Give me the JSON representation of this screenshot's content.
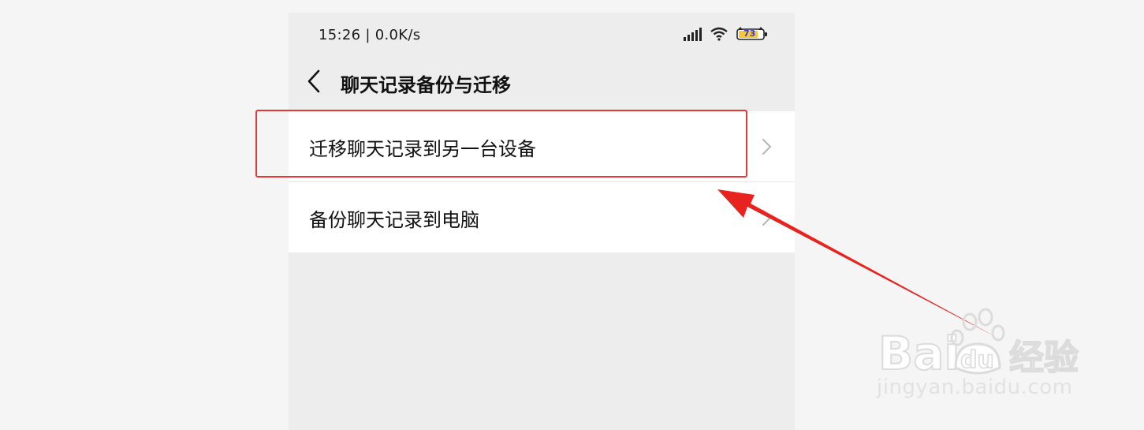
{
  "status": {
    "time_speed": "15:26 | 0.0K/s",
    "battery": "73"
  },
  "nav": {
    "title": "聊天记录备份与迁移"
  },
  "items": [
    {
      "label": "迁移聊天记录到另一台设备"
    },
    {
      "label": "备份聊天记录到电脑"
    }
  ],
  "watermark": {
    "brand": "Bai  du 经验",
    "url": "jingyan.baidu.com"
  },
  "colors": {
    "highlight": "#e53935",
    "page_bg": "#ededed"
  }
}
